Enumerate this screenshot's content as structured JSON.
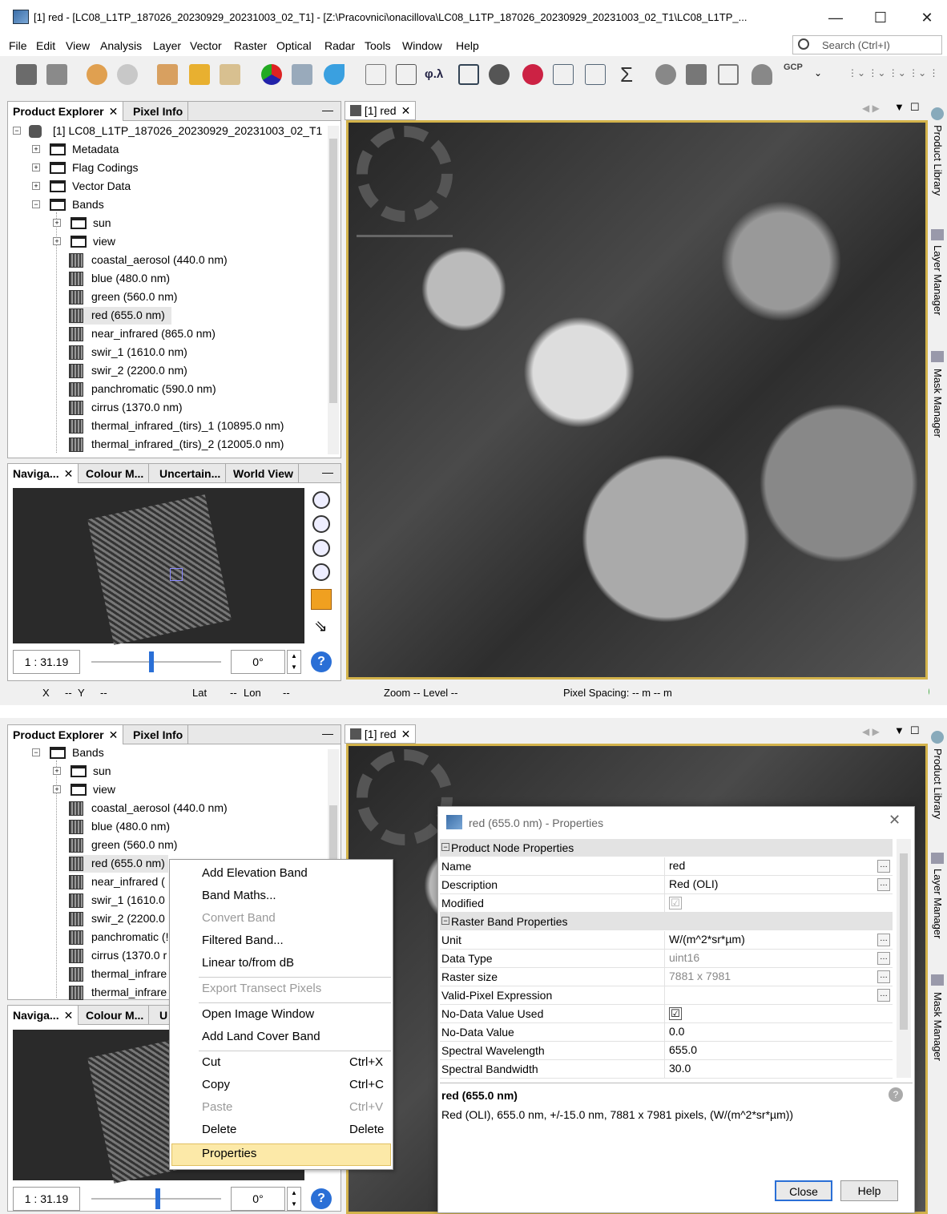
{
  "window": {
    "title": "[1] red - [LC08_L1TP_187026_20230929_20231003_02_T1] - [Z:\\Pracovnici\\onacillova\\LC08_L1TP_187026_20230929_20231003_02_T1\\LC08_L1TP_..."
  },
  "menu": [
    "File",
    "Edit",
    "View",
    "Analysis",
    "Layer",
    "Vector",
    "Raster",
    "Optical",
    "Radar",
    "Tools",
    "Window",
    "Help"
  ],
  "search": {
    "placeholder": "Search (Ctrl+I)"
  },
  "toolbar": {
    "gcp_label": "GCP",
    "phi_lambda": "φ.λ",
    "sigma": "Σ"
  },
  "product_explorer": {
    "tabs": [
      "Product Explorer",
      "Pixel Info"
    ],
    "root": "[1] LC08_L1TP_187026_20230929_20231003_02_T1",
    "groups": [
      "Metadata",
      "Flag Codings",
      "Vector Data",
      "Bands"
    ],
    "band_folders": [
      "sun",
      "view"
    ],
    "bands": [
      "coastal_aerosol (440.0 nm)",
      "blue (480.0 nm)",
      "green (560.0 nm)",
      "red (655.0 nm)",
      "near_infrared (865.0 nm)",
      "swir_1 (1610.0 nm)",
      "swir_2 (2200.0 nm)",
      "panchromatic (590.0 nm)",
      "cirrus (1370.0 nm)",
      "thermal_infrared_(tirs)_1 (10895.0 nm)",
      "thermal_infrared_(tirs)_2 (12005.0 nm)"
    ],
    "bands_truncated": [
      "coastal_aerosol (440.0 nm)",
      "blue (480.0 nm)",
      "green (560.0 nm)",
      "red (655.0 nm)",
      "near_infrared (",
      "swir_1 (1610.0",
      "swir_2 (2200.0",
      "panchromatic (!",
      "cirrus (1370.0 r",
      "thermal_infrare",
      "thermal_infrare"
    ]
  },
  "nav_panel": {
    "tabs": [
      "Naviga...",
      "Colour M...",
      "Uncertain...",
      "World View"
    ],
    "tabs_lower": [
      "Naviga...",
      "Colour M...",
      "U"
    ],
    "scale": "1 : 31.19",
    "rotation": "0°"
  },
  "image_view": {
    "tab": "[1] red"
  },
  "right_tabs": [
    "Product Library",
    "Layer Manager",
    "Mask Manager"
  ],
  "status": {
    "x": "X",
    "x_val": "--",
    "y": "Y",
    "y_val": "--",
    "lat": "Lat",
    "lat_val": "--",
    "lon": "Lon",
    "lon_val": "--",
    "zoom": "Zoom -- Level --",
    "pixel_spacing": "Pixel Spacing: -- m -- m"
  },
  "context_menu": {
    "items": [
      {
        "label": "Add Elevation Band",
        "enabled": true
      },
      {
        "label": "Band Maths...",
        "enabled": true
      },
      {
        "label": "Convert Band",
        "enabled": false
      },
      {
        "label": "Filtered Band...",
        "enabled": true
      },
      {
        "label": "Linear to/from dB",
        "enabled": true
      },
      {
        "label": "Export Transect Pixels",
        "enabled": false
      },
      {
        "label": "Open Image Window",
        "enabled": true
      },
      {
        "label": "Add Land Cover Band",
        "enabled": true
      },
      {
        "label": "Cut",
        "shortcut": "Ctrl+X",
        "enabled": true
      },
      {
        "label": "Copy",
        "shortcut": "Ctrl+C",
        "enabled": true
      },
      {
        "label": "Paste",
        "shortcut": "Ctrl+V",
        "enabled": false
      },
      {
        "label": "Delete",
        "shortcut": "Delete",
        "enabled": true
      },
      {
        "label": "Properties",
        "enabled": true,
        "highlighted": true
      }
    ]
  },
  "properties_dialog": {
    "title": "red (655.0 nm) - Properties",
    "group1": "Product Node Properties",
    "group2": "Raster Band Properties",
    "rows": [
      {
        "key": "Name",
        "value": "red"
      },
      {
        "key": "Description",
        "value": "Red (OLI)"
      },
      {
        "key": "Modified",
        "value": "☑"
      },
      {
        "key": "Unit",
        "value": "W/(m^2*sr*µm)"
      },
      {
        "key": "Data Type",
        "value": "uint16"
      },
      {
        "key": "Raster size",
        "value": "7881 x 7981"
      },
      {
        "key": "Valid-Pixel Expression",
        "value": ""
      },
      {
        "key": "No-Data Value Used",
        "value": "☑"
      },
      {
        "key": "No-Data Value",
        "value": "0.0"
      },
      {
        "key": "Spectral Wavelength",
        "value": "655.0"
      },
      {
        "key": "Spectral Bandwidth",
        "value": "30.0"
      }
    ],
    "summary_title": "red (655.0 nm)",
    "summary_text": "Red (OLI), 655.0 nm, +/-15.0 nm, 7881 x 7981 pixels, (W/(m^2*sr*µm))",
    "close_label": "Close",
    "help_label": "Help"
  }
}
